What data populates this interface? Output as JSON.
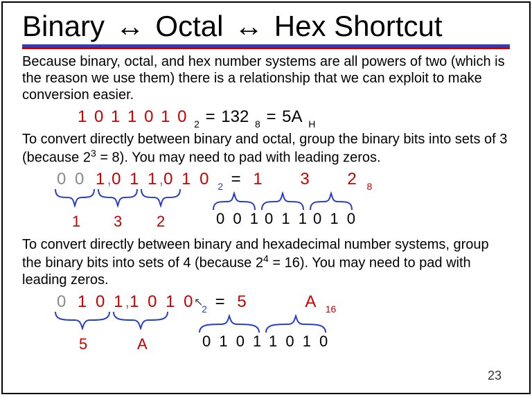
{
  "title": {
    "part1": "Binary",
    "arrow": "↔",
    "part2": "Octal",
    "part3": "Hex Shortcut"
  },
  "intro": "Because binary, octal, and hex number systems are all powers of two (which is the reason we use them) there is a relationship that we can exploit to make conversion easier.",
  "eq1": {
    "binary": "1 0 1 1 0 1 0",
    "binary_base": "2",
    "eq": "=",
    "octal": "132",
    "octal_base": "8",
    "hex": "5A",
    "hex_base": "H"
  },
  "para_octal_a": "To convert directly between binary and octal, group the binary bits into sets of 3 (because 2",
  "para_octal_exp": "3",
  "para_octal_b": " = 8). You may need to pad with leading zeros.",
  "octal_diagram": {
    "pad": "0 0",
    "bits": "1 0 1 1 0 1 0",
    "base": "2",
    "eq": "=",
    "result_digits": [
      "1",
      "3",
      "2"
    ],
    "result_base": "8",
    "octal_labels": [
      "1",
      "3",
      "2"
    ],
    "bin_groups": [
      "0 0 1",
      "0 1 1",
      "0 1 0"
    ]
  },
  "para_hex_a": "To convert directly between binary and hexadecimal number systems, group the binary bits into sets of 4 (because 2",
  "para_hex_exp": "4",
  "para_hex_b": " = 16). You may need to pad with leading zeros.",
  "hex_diagram": {
    "pad": "0",
    "bits": "1 0 1 1 0 1 0",
    "base": "2",
    "eq": "=",
    "result_digits": [
      "5",
      "A"
    ],
    "result_base": "16",
    "hex_labels": [
      "5",
      "A"
    ],
    "bin_groups": [
      "0 1 0 1",
      "1 0 1 0"
    ]
  },
  "page_number": "23"
}
